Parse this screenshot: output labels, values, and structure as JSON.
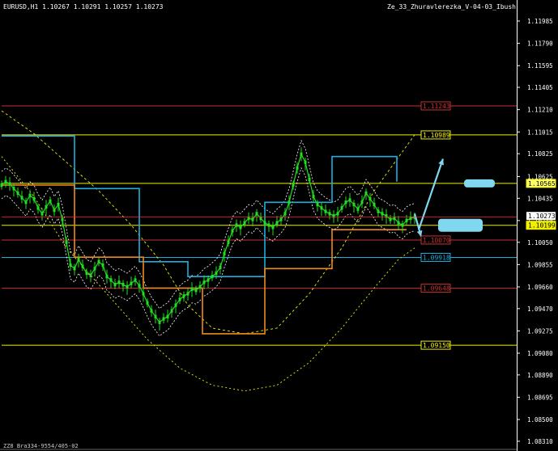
{
  "header": {
    "symbol_info": "EURUSD,H1  1.10267 1.10291 1.10257 1.10273",
    "indicator_name": "Ze_33_Zhuravlerezka_V-04-03_Ibush"
  },
  "footer": {
    "text": "ZZ8 Bra334-9554/405-02"
  },
  "colors": {
    "background": "#000000",
    "axis": "#ffffff",
    "candles": "#22dd22",
    "step_blue": "#1eaee0",
    "step_orange": "#f08a1e",
    "yellow_line": "#f0f000",
    "envelope": "#ffffff",
    "arrow": "#7fd8f0"
  },
  "chart_data": {
    "type": "line",
    "symbol": "EURUSD",
    "timeframe": "H1",
    "y_ticks": [
      "1.11985",
      "1.11790",
      "1.11595",
      "1.11405",
      "1.11210",
      "1.11015",
      "1.10825",
      "1.10625",
      "1.10435",
      "1.10240",
      "1.10050",
      "1.09855",
      "1.09660",
      "1.09470",
      "1.09275",
      "1.09080",
      "1.08890",
      "1.08695",
      "1.08500",
      "1.08310"
    ],
    "y_tick_values": [
      1.11985,
      1.1179,
      1.11595,
      1.11405,
      1.1121,
      1.11015,
      1.10825,
      1.10625,
      1.10435,
      1.1024,
      1.1005,
      1.09855,
      1.0966,
      1.0947,
      1.09275,
      1.0908,
      1.0889,
      1.08695,
      1.085,
      1.0831
    ],
    "ylim": [
      1.0826,
      1.1207
    ],
    "current_price": {
      "label": "1.10273",
      "value": 1.10273
    },
    "levels": [
      {
        "label": "1.11243",
        "value": 1.11243,
        "color": "#c83232",
        "boxed": true
      },
      {
        "label": "1.10989",
        "value": 1.10989,
        "color": "#f0f000",
        "boxed": true
      },
      {
        "label": "1.10565",
        "value": 1.10565,
        "color": "#f0f000",
        "boxed": true,
        "on_axis": true
      },
      {
        "label": "1.10199",
        "value": 1.10199,
        "color": "#f0f000",
        "boxed": true,
        "on_axis": true
      },
      {
        "label": "1.10070",
        "value": 1.1007,
        "color": "#c83232",
        "boxed": true
      },
      {
        "label": "1.09918",
        "value": 1.09918,
        "color": "#1eaee0",
        "boxed": true
      },
      {
        "label": "1.09648",
        "value": 1.09648,
        "color": "#c83232",
        "boxed": true
      },
      {
        "label": "1.09150",
        "value": 1.0915,
        "color": "#f0f000",
        "boxed": true
      }
    ],
    "series": [
      {
        "name": "",
        "kind": "price",
        "x": [
          0,
          5,
          10,
          15,
          20,
          25,
          30,
          35,
          40,
          45,
          50,
          55,
          60,
          65,
          70,
          75,
          80,
          85,
          90,
          95,
          100,
          105,
          110,
          115,
          120,
          125,
          130,
          135,
          140,
          145,
          150,
          155,
          160,
          165,
          170,
          175,
          180,
          185,
          190,
          195,
          200,
          205,
          210,
          215,
          220,
          225,
          230,
          235,
          240,
          245,
          250,
          255,
          260,
          265,
          270,
          275,
          280,
          285,
          290,
          295,
          300,
          305,
          310,
          315,
          320,
          325,
          330,
          335,
          340,
          345,
          350,
          355,
          360,
          365,
          370,
          375,
          380,
          385,
          390,
          395,
          400,
          405,
          410,
          415,
          420,
          425,
          430,
          435,
          440,
          445,
          450,
          455,
          460,
          465,
          470,
          475,
          480,
          485,
          490,
          495,
          500,
          505,
          510
        ],
        "values": [
          1.1055,
          1.1058,
          1.1056,
          1.1052,
          1.1048,
          1.1044,
          1.104,
          1.1046,
          1.1043,
          1.1035,
          1.103,
          1.1036,
          1.1041,
          1.1033,
          1.1038,
          1.1025,
          1.1005,
          1.0985,
          1.0982,
          1.099,
          1.0984,
          1.0978,
          1.0976,
          1.0982,
          1.0988,
          1.0985,
          1.0975,
          1.0972,
          1.0968,
          1.097,
          1.0968,
          1.0966,
          1.0969,
          1.0972,
          1.0967,
          1.096,
          1.0952,
          1.0945,
          1.094,
          1.0935,
          1.0938,
          1.094,
          1.0945,
          1.095,
          1.0955,
          1.0958,
          1.096,
          1.0964,
          1.0963,
          1.0966,
          1.097,
          1.0972,
          1.0975,
          1.0978,
          1.0983,
          1.0995,
          1.1005,
          1.1015,
          1.102,
          1.1018,
          1.1022,
          1.1026,
          1.1025,
          1.103,
          1.1026,
          1.1022,
          1.102,
          1.1018,
          1.1022,
          1.1025,
          1.103,
          1.104,
          1.1055,
          1.107,
          1.1082,
          1.1075,
          1.106,
          1.1045,
          1.1038,
          1.1035,
          1.1032,
          1.103,
          1.1028,
          1.103,
          1.1035,
          1.104,
          1.1042,
          1.1038,
          1.1034,
          1.104,
          1.1048,
          1.1043,
          1.1038,
          1.1032,
          1.103,
          1.1028,
          1.1025,
          1.1026,
          1.1022,
          1.102,
          1.1024,
          1.1026,
          1.1027
        ]
      },
      {
        "name": "",
        "kind": "step_blue",
        "x": [
          0,
          90,
          90,
          170,
          170,
          230,
          230,
          325,
          325,
          408,
          408,
          488,
          488
        ],
        "values": [
          1.1098,
          1.1098,
          1.1052,
          1.1052,
          1.0988,
          1.0988,
          1.0975,
          1.0975,
          1.104,
          1.104,
          1.108,
          1.108,
          1.1058
        ]
      },
      {
        "name": "",
        "kind": "step_orange",
        "x": [
          0,
          90,
          90,
          175,
          175,
          248,
          248,
          325,
          325,
          408,
          408,
          500
        ],
        "values": [
          1.1055,
          1.1055,
          1.0992,
          1.0992,
          1.0965,
          1.0965,
          1.0925,
          1.0925,
          1.0982,
          1.0982,
          1.1016,
          1.1016
        ]
      },
      {
        "name": "",
        "kind": "yellow_diag",
        "x": [
          0,
          40,
          80,
          120,
          160,
          200,
          230,
          260,
          300,
          340,
          380,
          420,
          460,
          510
        ],
        "values": [
          1.112,
          1.11,
          1.1075,
          1.105,
          1.102,
          1.0985,
          1.095,
          1.093,
          1.0925,
          1.093,
          1.096,
          1.1,
          1.105,
          1.1099
        ]
      },
      {
        "name": "",
        "kind": "yellow_lower",
        "x": [
          0,
          40,
          80,
          130,
          180,
          220,
          260,
          300,
          340,
          380,
          420,
          460,
          490,
          510
        ],
        "values": [
          1.108,
          1.1045,
          1.1,
          1.096,
          1.092,
          1.0895,
          1.088,
          1.0875,
          1.088,
          1.09,
          1.093,
          1.0965,
          1.099,
          1.1
        ]
      }
    ],
    "arrows": [
      {
        "from": [
          515,
          1.1016
        ],
        "to": [
          545,
          1.1078
        ]
      },
      {
        "from": [
          510,
          1.103
        ],
        "to": [
          518,
          1.101
        ]
      }
    ],
    "grid": false
  }
}
